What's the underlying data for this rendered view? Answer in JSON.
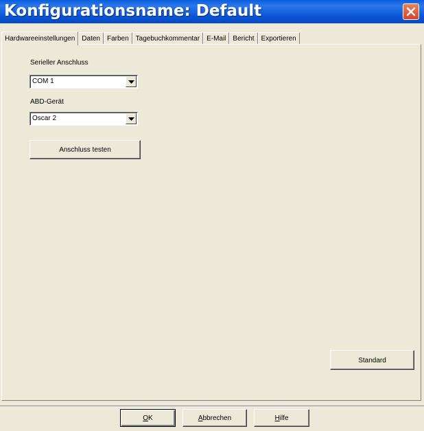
{
  "window": {
    "title": "Konfigurationsname: Default"
  },
  "tabs": [
    {
      "label": "Hardwareeinstellungen",
      "active": true
    },
    {
      "label": "Daten",
      "active": false
    },
    {
      "label": "Farben",
      "active": false
    },
    {
      "label": "Tagebuchkommentar",
      "active": false
    },
    {
      "label": "E-Mail",
      "active": false
    },
    {
      "label": "Bericht",
      "active": false
    },
    {
      "label": "Exportieren",
      "active": false
    }
  ],
  "hardware": {
    "serial_port_label": "Serieller Anschluss",
    "serial_port_value": "COM 1",
    "device_label": "ABD-Gerät",
    "device_value": "Oscar 2",
    "test_button": "Anschluss testen",
    "standard_button": "Standard"
  },
  "footer": {
    "ok_prefix": "",
    "ok_mnemonic": "O",
    "ok_rest": "K",
    "cancel_mnemonic": "A",
    "cancel_rest": "bbrechen",
    "help_mnemonic": "H",
    "help_rest": "ilfe"
  },
  "colors": {
    "titlebar": "#0a55d5",
    "face": "#ece9d8",
    "close": "#d3462a"
  },
  "icons": {
    "close": "close-icon",
    "dropdown": "chevron-down-icon"
  }
}
